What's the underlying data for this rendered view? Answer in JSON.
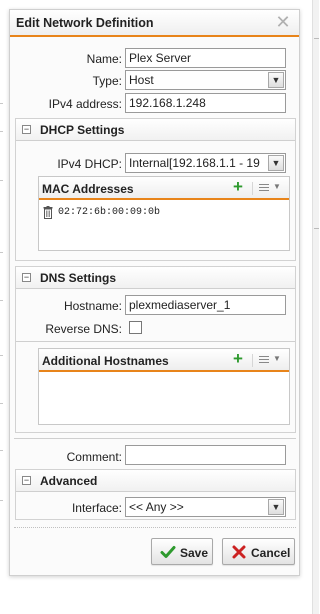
{
  "dialog": {
    "title": "Edit Network Definition",
    "close_icon": "close-icon"
  },
  "fields": {
    "name_label": "Name:",
    "name_value": "Plex Server",
    "type_label": "Type:",
    "type_value": "Host",
    "ipv4_label": "IPv4 address:",
    "ipv4_value": "192.168.1.248"
  },
  "dhcp": {
    "title": "DHCP Settings",
    "ipv4_dhcp_label": "IPv4 DHCP:",
    "ipv4_dhcp_value": "Internal[192.168.1.1 - 19",
    "mac_grid": {
      "title": "MAC Addresses",
      "rows": [
        "02:72:6b:00:09:0b"
      ]
    }
  },
  "dns": {
    "title": "DNS Settings",
    "hostname_label": "Hostname:",
    "hostname_value": "plexmediaserver_1",
    "reverse_dns_label": "Reverse DNS:",
    "reverse_dns_checked": false,
    "hostnames_grid": {
      "title": "Additional Hostnames",
      "rows": []
    }
  },
  "comment": {
    "label": "Comment:",
    "value": ""
  },
  "advanced": {
    "title": "Advanced",
    "interface_label": "Interface:",
    "interface_value": "<< Any >>"
  },
  "buttons": {
    "save_label": "Save",
    "cancel_label": "Cancel"
  },
  "colors": {
    "accent": "#e8841a",
    "save_check": "#2e9a2e",
    "cancel_x": "#cc2222",
    "plus": "#2e9a2e"
  }
}
